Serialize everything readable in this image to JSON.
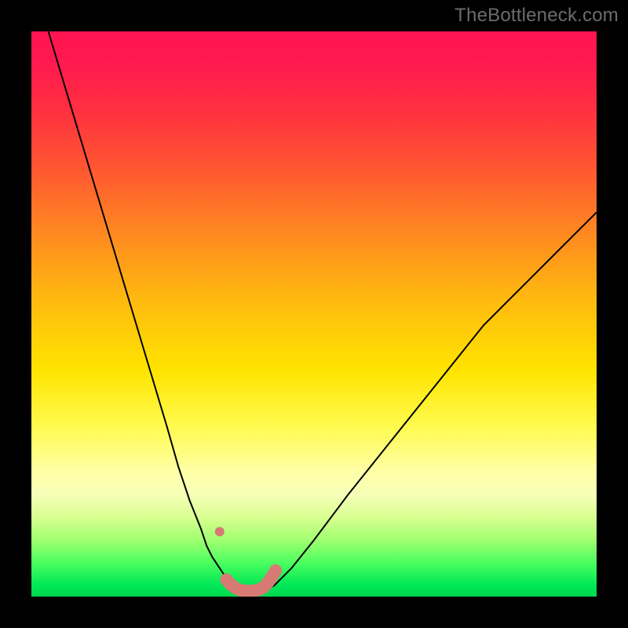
{
  "watermark": "TheBottleneck.com",
  "chart_data": {
    "type": "line",
    "title": "",
    "xlabel": "",
    "ylabel": "",
    "xlim": [
      0,
      100
    ],
    "ylim": [
      0,
      100
    ],
    "grid": false,
    "legend": false,
    "series": [
      {
        "name": "left-curve",
        "x": [
          3,
          6,
          9,
          12,
          15,
          18,
          21,
          24,
          26,
          28,
          30,
          31,
          32,
          33,
          34,
          34.8,
          35.5,
          36,
          36.5
        ],
        "y": [
          100,
          90,
          80,
          70,
          60,
          50,
          40,
          30,
          23,
          17,
          12,
          9,
          7,
          5.5,
          4,
          3,
          2.3,
          1.8,
          1.4
        ],
        "color": "#000000",
        "stroke_width": 2
      },
      {
        "name": "right-curve",
        "x": [
          42,
          43,
          44,
          46,
          48,
          50,
          53,
          56,
          60,
          64,
          68,
          72,
          76,
          80,
          84,
          88,
          92,
          96,
          100
        ],
        "y": [
          1.4,
          2.0,
          3.0,
          5.0,
          7.5,
          10,
          14,
          18,
          23,
          28,
          33,
          38,
          43,
          48,
          52,
          56,
          60,
          64,
          68
        ],
        "color": "#000000",
        "stroke_width": 2
      },
      {
        "name": "highlight-left-dot",
        "x": [
          33.3
        ],
        "y": [
          11.5
        ],
        "color": "#d77a74",
        "marker": "circle",
        "radius": 6
      },
      {
        "name": "highlight-bottom-bar",
        "x": [
          34.5,
          35.2,
          36,
          36.8,
          37.6,
          38.5,
          39.3,
          40.2,
          41,
          41.8,
          42.5,
          43.2
        ],
        "y": [
          3.0,
          2.2,
          1.6,
          1.2,
          1.0,
          1.0,
          1.0,
          1.2,
          1.6,
          2.4,
          3.4,
          4.6
        ],
        "color": "#d77a74",
        "stroke_width": 16,
        "cap": "round"
      }
    ],
    "background_gradient_stops": [
      {
        "pos": 0.0,
        "color": "#ff1452"
      },
      {
        "pos": 0.25,
        "color": "#ff5a30"
      },
      {
        "pos": 0.5,
        "color": "#ffc810"
      },
      {
        "pos": 0.7,
        "color": "#fffb50"
      },
      {
        "pos": 0.82,
        "color": "#f6ffb8"
      },
      {
        "pos": 0.94,
        "color": "#4cff60"
      },
      {
        "pos": 1.0,
        "color": "#00d84f"
      }
    ]
  }
}
